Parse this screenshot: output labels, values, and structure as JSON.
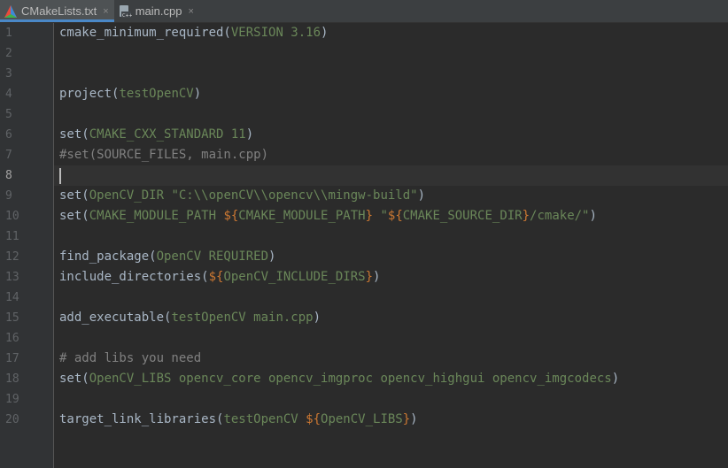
{
  "tabs": [
    {
      "label": "CMakeLists.txt",
      "icon": "cmake-icon",
      "active": true,
      "close": "×"
    },
    {
      "label": "main.cpp",
      "icon": "cpp-file-icon",
      "active": false,
      "close": "×"
    }
  ],
  "colors": {
    "background": "#2b2b2b",
    "default_text": "#a9b7c6",
    "argument": "#6a8759",
    "variable_brace": "#cc7832",
    "comment": "#808080",
    "line_number": "#606366"
  },
  "current_line": 8,
  "lines": [
    {
      "num": "1",
      "segments": [
        {
          "t": "cmake_minimum_required(",
          "c": "d"
        },
        {
          "t": "VERSION 3.16",
          "c": "g"
        },
        {
          "t": ")",
          "c": "d"
        }
      ]
    },
    {
      "num": "2",
      "segments": []
    },
    {
      "num": "3",
      "segments": []
    },
    {
      "num": "4",
      "segments": [
        {
          "t": "project(",
          "c": "d"
        },
        {
          "t": "testOpenCV",
          "c": "g"
        },
        {
          "t": ")",
          "c": "d"
        }
      ]
    },
    {
      "num": "5",
      "segments": []
    },
    {
      "num": "6",
      "segments": [
        {
          "t": "set(",
          "c": "d"
        },
        {
          "t": "CMAKE_CXX_STANDARD 11",
          "c": "g"
        },
        {
          "t": ")",
          "c": "d"
        }
      ]
    },
    {
      "num": "7",
      "segments": [
        {
          "t": "#set(SOURCE_FILES, main.cpp)",
          "c": "c"
        }
      ]
    },
    {
      "num": "8",
      "segments": []
    },
    {
      "num": "9",
      "segments": [
        {
          "t": "set(",
          "c": "d"
        },
        {
          "t": "OpenCV_DIR ",
          "c": "g"
        },
        {
          "t": "\"C:\\\\openCV\\\\opencv\\\\mingw-build\"",
          "c": "g"
        },
        {
          "t": ")",
          "c": "d"
        }
      ]
    },
    {
      "num": "10",
      "segments": [
        {
          "t": "set(",
          "c": "d"
        },
        {
          "t": "CMAKE_MODULE_PATH ",
          "c": "g"
        },
        {
          "t": "${",
          "c": "b"
        },
        {
          "t": "CMAKE_MODULE_PATH",
          "c": "g"
        },
        {
          "t": "}",
          "c": "b"
        },
        {
          "t": " \"",
          "c": "g"
        },
        {
          "t": "${",
          "c": "b"
        },
        {
          "t": "CMAKE_SOURCE_DIR",
          "c": "g"
        },
        {
          "t": "}",
          "c": "b"
        },
        {
          "t": "/cmake/\"",
          "c": "g"
        },
        {
          "t": ")",
          "c": "d"
        }
      ]
    },
    {
      "num": "11",
      "segments": []
    },
    {
      "num": "12",
      "segments": [
        {
          "t": "find_package(",
          "c": "d"
        },
        {
          "t": "OpenCV REQUIRED",
          "c": "g"
        },
        {
          "t": ")",
          "c": "d"
        }
      ]
    },
    {
      "num": "13",
      "segments": [
        {
          "t": "include_directories(",
          "c": "d"
        },
        {
          "t": "${",
          "c": "b"
        },
        {
          "t": "OpenCV_INCLUDE_DIRS",
          "c": "g"
        },
        {
          "t": "}",
          "c": "b"
        },
        {
          "t": ")",
          "c": "d"
        }
      ]
    },
    {
      "num": "14",
      "segments": []
    },
    {
      "num": "15",
      "segments": [
        {
          "t": "add_executable(",
          "c": "d"
        },
        {
          "t": "testOpenCV main.cpp",
          "c": "g"
        },
        {
          "t": ")",
          "c": "d"
        }
      ]
    },
    {
      "num": "16",
      "segments": []
    },
    {
      "num": "17",
      "segments": [
        {
          "t": "# add libs you need",
          "c": "c"
        }
      ]
    },
    {
      "num": "18",
      "segments": [
        {
          "t": "set(",
          "c": "d"
        },
        {
          "t": "OpenCV_LIBS opencv_core opencv_imgproc opencv_highgui opencv_imgcodecs",
          "c": "g"
        },
        {
          "t": ")",
          "c": "d"
        }
      ]
    },
    {
      "num": "19",
      "segments": []
    },
    {
      "num": "20",
      "segments": [
        {
          "t": "target_link_libraries(",
          "c": "d"
        },
        {
          "t": "testOpenCV ",
          "c": "g"
        },
        {
          "t": "${",
          "c": "b"
        },
        {
          "t": "OpenCV_LIBS",
          "c": "g"
        },
        {
          "t": "}",
          "c": "b"
        },
        {
          "t": ")",
          "c": "d"
        }
      ]
    }
  ]
}
